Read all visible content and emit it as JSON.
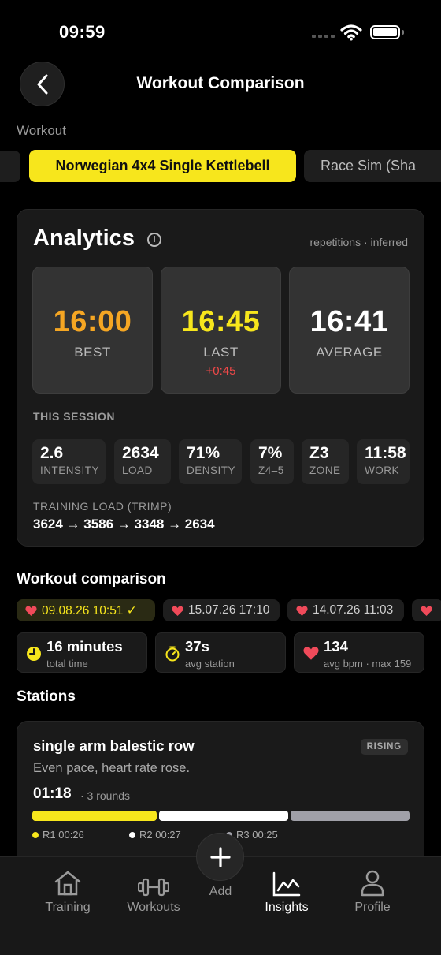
{
  "status": {
    "time": "09:59"
  },
  "nav": {
    "title": "Workout Comparison"
  },
  "workout_section": {
    "label": "Workout"
  },
  "workout_chips": [
    {
      "label": "Norwegian 4x4 Single Kettlebell",
      "selected": true
    },
    {
      "label": "Race Sim (Sha",
      "selected": false
    }
  ],
  "analytics": {
    "title": "Analytics",
    "meta": "repetitions · inferred",
    "stats": [
      {
        "value": "16:00",
        "label": "BEST",
        "color": "#f5a623",
        "delta": ""
      },
      {
        "value": "16:45",
        "label": "LAST",
        "color": "#f7e61c",
        "delta": "+0:45"
      },
      {
        "value": "16:41",
        "label": "AVERAGE",
        "color": "#ffffff",
        "delta": ""
      }
    ],
    "session_label": "THIS SESSION",
    "metrics": [
      {
        "value": "2.6",
        "label": "INTENSITY"
      },
      {
        "value": "2634",
        "label": "LOAD"
      },
      {
        "value": "71%",
        "label": "DENSITY"
      },
      {
        "value": "7%",
        "label": "Z4–5"
      },
      {
        "value": "Z3",
        "label": "ZONE"
      },
      {
        "value": "11:58",
        "label": "WORK"
      }
    ],
    "trimp_label": "TRAINING LOAD (TRIMP)",
    "trimp_values": "3624 → 3586 → 3348 → 2634"
  },
  "comparison": {
    "heading": "Workout comparison",
    "dates": [
      {
        "label": "09.08.26 10:51 ✓",
        "active": true
      },
      {
        "label": "15.07.26 17:10",
        "active": false
      },
      {
        "label": "14.07.26 11:03",
        "active": false
      }
    ],
    "summary": [
      {
        "icon": "clock-icon",
        "value": "16 minutes",
        "sub": "total time"
      },
      {
        "icon": "timer-icon",
        "value": "37s",
        "sub": "avg station"
      },
      {
        "icon": "heart-icon",
        "value": "134",
        "sub": "avg bpm · max 159"
      }
    ]
  },
  "stations": {
    "heading": "Stations",
    "items": [
      {
        "name": "single arm balestic row",
        "badge": "RISING",
        "description": "Even pace, heart rate rose.",
        "time": "01:18",
        "rounds": "· 3 rounds",
        "round_data": [
          {
            "label": "R1  00:26",
            "color": "#f7e61c"
          },
          {
            "label": "R2  00:27",
            "color": "#ffffff"
          },
          {
            "label": "R3  00:25",
            "color": "#a0a0a8"
          }
        ]
      }
    ]
  },
  "tabs": [
    {
      "label": "Training",
      "icon": "house-icon"
    },
    {
      "label": "Workouts",
      "icon": "dumbbell-icon"
    },
    {
      "label": "Add",
      "icon": "plus-icon"
    },
    {
      "label": "Insights",
      "icon": "chart-icon",
      "active": true
    },
    {
      "label": "Profile",
      "icon": "person-icon"
    }
  ]
}
